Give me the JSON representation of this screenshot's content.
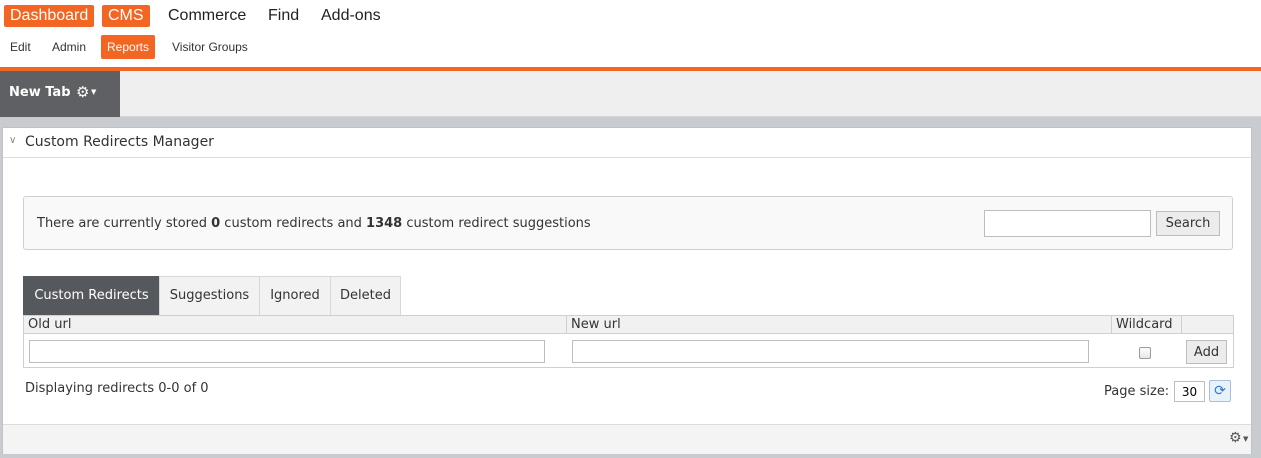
{
  "topnav": {
    "items": [
      {
        "label": "Dashboard",
        "active": true
      },
      {
        "label": "CMS",
        "active": true
      },
      {
        "label": "Commerce",
        "active": false
      },
      {
        "label": "Find",
        "active": false
      },
      {
        "label": "Add-ons",
        "active": false
      }
    ]
  },
  "subnav": {
    "items": [
      {
        "label": "Edit",
        "active": false
      },
      {
        "label": "Admin",
        "active": false
      },
      {
        "label": "Reports",
        "active": true
      },
      {
        "label": "Visitor Groups",
        "active": false
      }
    ]
  },
  "tabstrip": {
    "new_tab_label": "New Tab",
    "icons": {
      "settings": "gear-icon",
      "menu": "caret-down-icon"
    }
  },
  "gadget": {
    "title": "Custom Redirects Manager",
    "summary": {
      "prefix": "There are currently stored ",
      "redirect_count": "0",
      "middle": " custom redirects and ",
      "suggestion_count": "1348",
      "suffix": " custom redirect suggestions"
    },
    "search": {
      "value": "",
      "button_label": "Search"
    },
    "tabs": [
      {
        "label": "Custom Redirects",
        "active": true
      },
      {
        "label": "Suggestions",
        "active": false
      },
      {
        "label": "Ignored",
        "active": false
      },
      {
        "label": "Deleted",
        "active": false
      }
    ],
    "grid": {
      "columns": [
        "Old url",
        "New url",
        "Wildcard",
        ""
      ],
      "old_url_value": "",
      "new_url_value": "",
      "wildcard_checked": false,
      "add_label": "Add"
    },
    "displaying": "Displaying redirects 0-0 of 0",
    "page_size_label": "Page size:",
    "page_size_value": "30"
  },
  "colors": {
    "accent": "#f26522",
    "active_tab": "#55585c",
    "workspace_bg": "#c8ccd1"
  }
}
